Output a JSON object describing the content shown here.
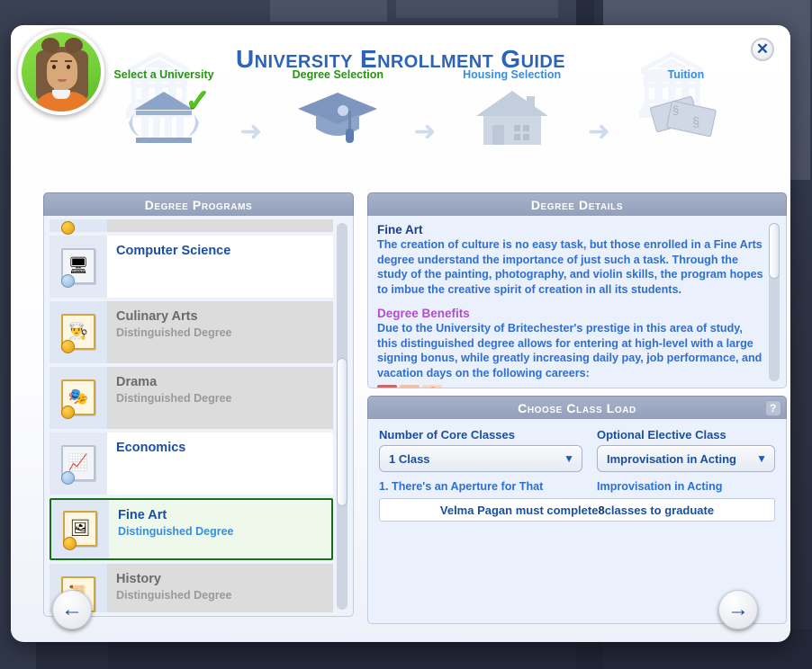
{
  "header": {
    "title": "University Enrollment Guide",
    "close_label": "✕",
    "steps": [
      {
        "label": "Select a University",
        "icon": "university-building-icon",
        "state": "done",
        "check": "✓"
      },
      {
        "label": "Degree Selection",
        "icon": "graduation-cap-icon",
        "state": "active",
        "check": ""
      },
      {
        "label": "Housing Selection",
        "icon": "house-icon",
        "state": "todo",
        "check": ""
      },
      {
        "label": "Tuition",
        "icon": "money-bills-icon",
        "state": "todo",
        "check": ""
      }
    ],
    "arrow": "➜"
  },
  "avatar": {
    "name": "sim-portrait"
  },
  "left_panel": {
    "header": "Degree Programs",
    "partial_row_above": true,
    "items": [
      {
        "name": "Computer Science",
        "sub": "",
        "icon": "computer-certificate-icon",
        "glyph": "🖥",
        "style": "white"
      },
      {
        "name": "Culinary Arts",
        "sub": "Distinguished Degree",
        "icon": "chef-hat-certificate-icon",
        "glyph": "👨‍🍳",
        "style": "grey"
      },
      {
        "name": "Drama",
        "sub": "Distinguished Degree",
        "icon": "theater-masks-certificate-icon",
        "glyph": "🎭",
        "style": "grey"
      },
      {
        "name": "Economics",
        "sub": "",
        "icon": "easel-chart-certificate-icon",
        "glyph": "📈",
        "style": "white"
      },
      {
        "name": "Fine Art",
        "sub": "Distinguished Degree",
        "icon": "framed-painting-certificate-icon",
        "glyph": "🖼",
        "style": "selected"
      },
      {
        "name": "History",
        "sub": "Distinguished Degree",
        "icon": "scroll-certificate-icon",
        "glyph": "📜",
        "style": "grey"
      }
    ]
  },
  "details_panel": {
    "header": "Degree Details",
    "degree_title": "Fine Art",
    "degree_description": "The creation of culture is no easy task, but those enrolled in a Fine Arts degree understand the importance of just such a task. Through the study of the painting, photography, and violin skills, the program hopes to imbue the creative spirit of creation in all its students.",
    "benefits_title": "Degree Benefits",
    "benefits_description": "Due to the University of Britechester's prestige in this area of study, this distinguished degree allows for entering at high-level with a large signing bonus, while greatly increasing daily pay, job performance, and vacation days on the following careers:"
  },
  "class_load_panel": {
    "header": "Choose Class Load",
    "help_label": "?",
    "core_label": "Number of Core Classes",
    "core_value": "1 Class",
    "core_class_list": [
      "1.  There's an Aperture for That"
    ],
    "elective_label": "Optional Elective Class",
    "elective_value": "Improvisation in Acting",
    "elective_class_list": [
      "Improvisation in Acting"
    ],
    "caret": "▼"
  },
  "status": {
    "prefix": "Velma Pagan must complete ",
    "count": "8",
    "suffix": " classes to graduate"
  },
  "footer": {
    "back_label": "←",
    "next_label": "→"
  },
  "colors": {
    "accent_blue": "#2d64b8",
    "link_blue": "#2f6fd0",
    "green": "#2a9216",
    "magenta": "#b04fc8",
    "panel_header": "#93a0bb",
    "selected_border": "#1a6b1a"
  }
}
